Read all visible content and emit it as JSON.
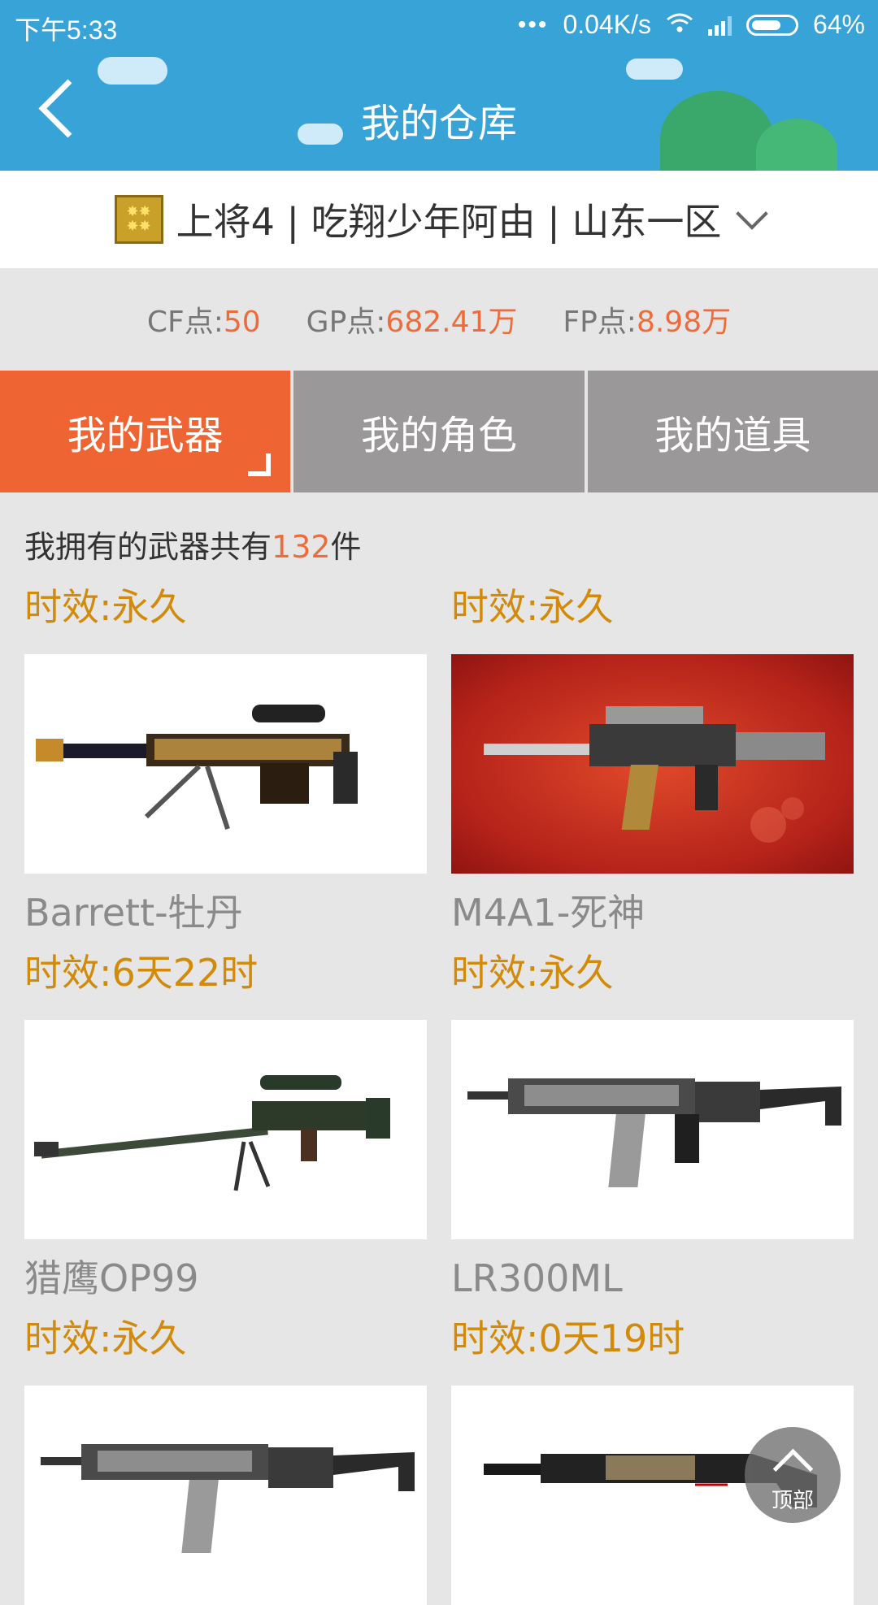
{
  "status_bar": {
    "time": "下午5:33",
    "network_speed": "0.04K/s",
    "battery": "64%"
  },
  "header": {
    "title": "我的仓库"
  },
  "user": {
    "info": "上将4 | 吃翔少年阿由 | 山东一区"
  },
  "points": {
    "cf_label": "CF点:",
    "cf_value": "50",
    "gp_label": "GP点:",
    "gp_value": "682.41万",
    "fp_label": "FP点:",
    "fp_value": "8.98万"
  },
  "tabs": [
    {
      "label": "我的武器",
      "active": true
    },
    {
      "label": "我的角色",
      "active": false
    },
    {
      "label": "我的道具",
      "active": false
    }
  ],
  "summary": {
    "prefix": "我拥有的武器共有",
    "count": "132",
    "suffix": "件"
  },
  "weapons": [
    {
      "validity": "时效:永久",
      "name": "Barrett-牡丹"
    },
    {
      "validity": "时效:永久",
      "name": "M4A1-死神"
    },
    {
      "validity": "时效:6天22时",
      "name": "猎鹰OP99"
    },
    {
      "validity": "时效:永久",
      "name": "LR300ML"
    },
    {
      "validity": "时效:永久",
      "name": ""
    },
    {
      "validity": "时效:0天19时",
      "name": ""
    }
  ],
  "back_to_top": {
    "label": "顶部"
  },
  "colors": {
    "header": "#37a3d6",
    "accent": "#ee6433",
    "validity": "#d28a0a"
  }
}
